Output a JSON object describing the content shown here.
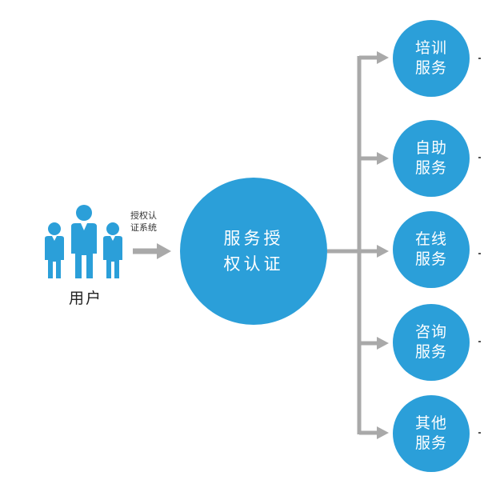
{
  "colors": {
    "circle": "#2b9fd9",
    "arrow": "#a9a9a9",
    "text_dark": "#222222"
  },
  "user": {
    "label": "用户",
    "icon": "people-group-icon"
  },
  "edge": {
    "line1": "授权认",
    "line2": "证系统"
  },
  "hub": {
    "line1": "服务授",
    "line2": "权认证"
  },
  "services": [
    {
      "line1": "培训",
      "line2": "服务"
    },
    {
      "line1": "自助",
      "line2": "服务"
    },
    {
      "line1": "在线",
      "line2": "服务"
    },
    {
      "line1": "咨询",
      "line2": "服务"
    },
    {
      "line1": "其他",
      "line2": "服务"
    }
  ]
}
